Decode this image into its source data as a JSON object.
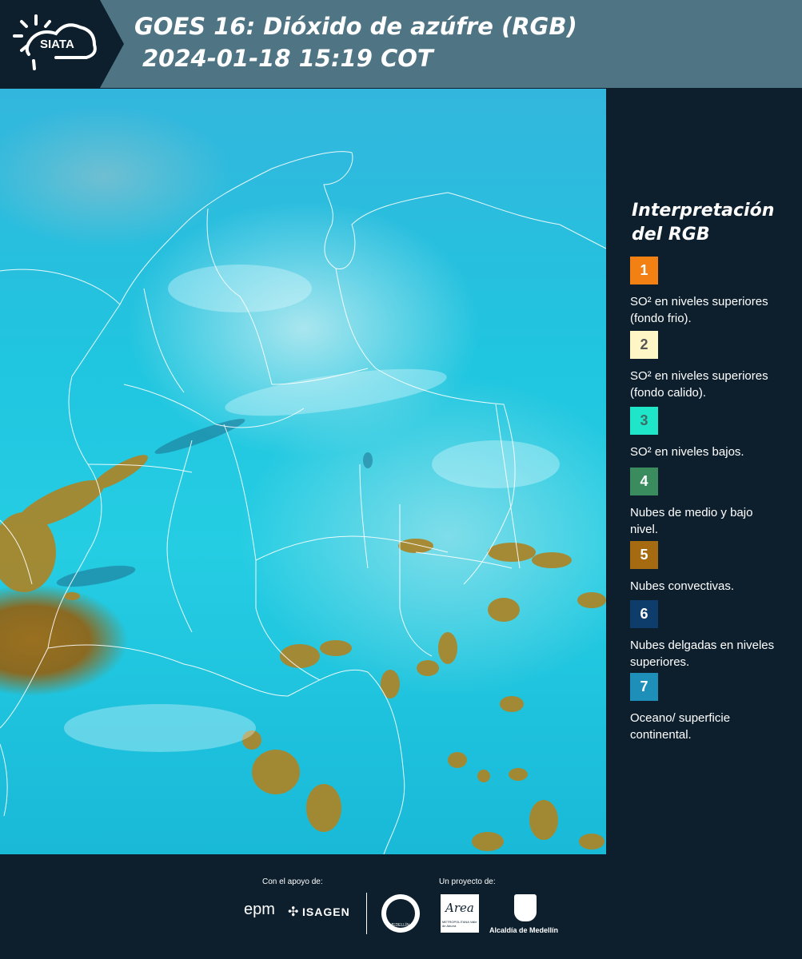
{
  "header": {
    "logo_text": "SIATA",
    "title_line1": "GOES 16: Dióxido de azúfre (RGB)",
    "title_line2": "2024-01-18 15:19 COT"
  },
  "legend": {
    "title": "Interpretación del RGB",
    "items": [
      {
        "number": "1",
        "color": "#f28012",
        "number_color": "#ffffff",
        "text": "SO² en niveles superiores (fondo frio)."
      },
      {
        "number": "2",
        "color": "#fff6c6",
        "number_color": "#555555",
        "text": "SO² en niveles superiores (fondo calido)."
      },
      {
        "number": "3",
        "color": "#1fe6c8",
        "number_color": "#3a6e66",
        "text": "SO² en niveles bajos."
      },
      {
        "number": "4",
        "color": "#3a8b5e",
        "number_color": "#ffffff",
        "text": "Nubes de medio y bajo nivel."
      },
      {
        "number": "5",
        "color": "#a66a10",
        "number_color": "#ffffff",
        "text": "Nubes convectivas."
      },
      {
        "number": "6",
        "color": "#0e3d6b",
        "number_color": "#ffffff",
        "text": "Nubes delgadas en niveles superiores."
      },
      {
        "number": "7",
        "color": "#1d8fb8",
        "number_color": "#ffffff",
        "text": "Oceano/ superficie continental."
      }
    ]
  },
  "footer": {
    "support_label": "Con el apoyo de:",
    "project_label": "Un proyecto de:",
    "epm": "epm",
    "isagen": "ISAGEN",
    "area_logo_text": "Area",
    "area_sub": "METROPOLITANA Valle de Aburrá",
    "alcaldia": "Alcaldía de Medellín",
    "seal_text": "MEDELLÍN"
  }
}
